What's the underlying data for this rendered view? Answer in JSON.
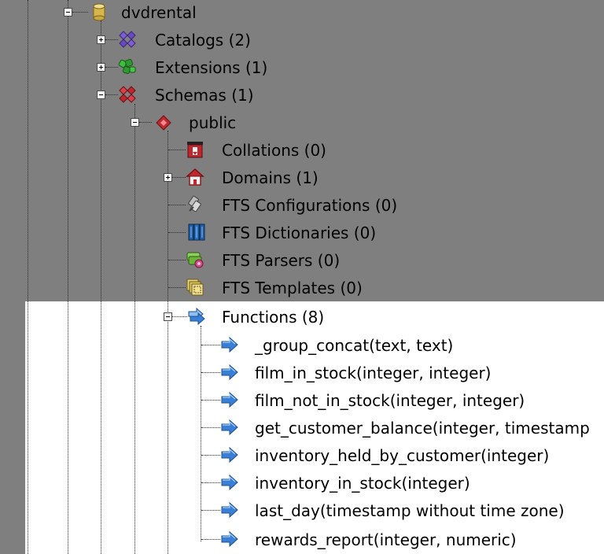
{
  "tree": {
    "database": {
      "label": "dvdrental",
      "expanded": true
    },
    "catalogs": {
      "label": "Catalogs (2)",
      "expanded": false
    },
    "extensions": {
      "label": "Extensions (1)",
      "expanded": false
    },
    "schemas": {
      "label": "Schemas (1)",
      "expanded": true
    },
    "schema_public": {
      "label": "public",
      "expanded": true
    },
    "collations": {
      "label": "Collations (0)"
    },
    "domains": {
      "label": "Domains (1)",
      "expanded": false
    },
    "fts_configurations": {
      "label": "FTS Configurations (0)"
    },
    "fts_dictionaries": {
      "label": "FTS Dictionaries (0)"
    },
    "fts_parsers": {
      "label": "FTS Parsers (0)"
    },
    "fts_templates": {
      "label": "FTS Templates (0)"
    },
    "functions": {
      "label": "Functions (8)",
      "expanded": true
    },
    "function_items": [
      {
        "label": "_group_concat(text, text)"
      },
      {
        "label": "film_in_stock(integer, integer)"
      },
      {
        "label": "film_not_in_stock(integer, integer)"
      },
      {
        "label": "get_customer_balance(integer, timestamp"
      },
      {
        "label": "inventory_held_by_customer(integer)"
      },
      {
        "label": "inventory_in_stock(integer)"
      },
      {
        "label": "last_day(timestamp without time zone)"
      },
      {
        "label": "rewards_report(integer, numeric)"
      }
    ]
  },
  "colors": {
    "background": "#7f7f7f",
    "highlight": "#ffffff",
    "function_arrow": "#3a7fd6",
    "schema_red": "#c0282d",
    "catalog_purple": "#6a4bbf",
    "extension_green": "#2f9a2f",
    "database_yellow": "#d8b74a"
  }
}
